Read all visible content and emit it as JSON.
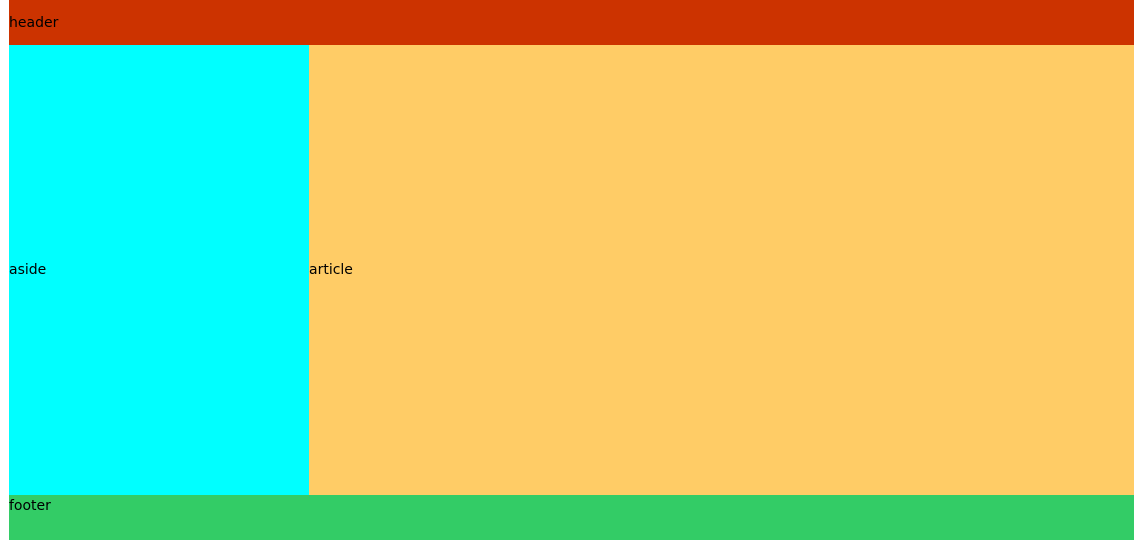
{
  "header": {
    "label": "header",
    "color": "#cc3300"
  },
  "aside": {
    "label": "aside",
    "color": "#00ffff"
  },
  "article": {
    "label": "article",
    "color": "#ffcc66"
  },
  "footer": {
    "label": "footer",
    "color": "#33cc66"
  }
}
